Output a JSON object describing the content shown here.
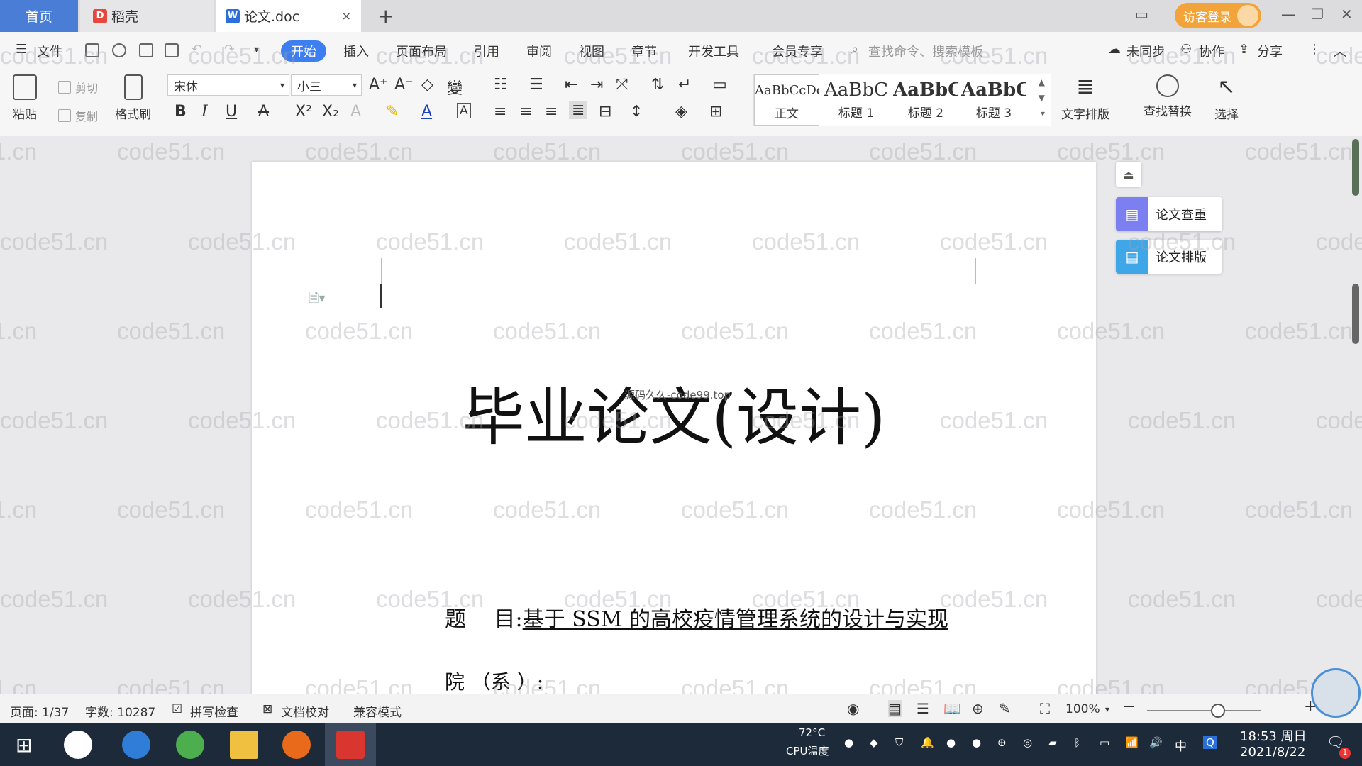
{
  "tabs": {
    "home": "首页",
    "daoke": "稻壳",
    "doc": "论文.doc",
    "close": "×",
    "add": "+"
  },
  "login": "访客登录",
  "menu": {
    "file": "文件",
    "start": "开始",
    "insert": "插入",
    "layout": "页面布局",
    "refs": "引用",
    "review": "审阅",
    "view": "视图",
    "chapter": "章节",
    "devtools": "开发工具",
    "member": "会员专享",
    "search_placeholder": "查找命令、搜索模板",
    "unsynced": "未同步",
    "collab": "协作",
    "share": "分享"
  },
  "ribbon": {
    "paste": "粘贴",
    "cut": "剪切",
    "copy": "复制",
    "format_painter": "格式刷",
    "font_name": "宋体",
    "font_size": "小三",
    "styles": [
      {
        "sample": "AaBbCcDd",
        "name": "正文"
      },
      {
        "sample": "AaBbC",
        "name": "标题 1"
      },
      {
        "sample": "AaBbC",
        "name": "标题 2"
      },
      {
        "sample": "AaBbC",
        "name": "标题 3"
      }
    ],
    "text_layout": "文字排版",
    "find_replace": "查找替换",
    "select": "选择"
  },
  "document": {
    "title": "毕业论文(设计)",
    "overlay": "源码久久-code99.top",
    "topic_label": "题　 目:",
    "topic_value": "基于 SSM 的高校疫情管理系统的设计与实现",
    "dept_label": "院 （系 ）:"
  },
  "side_panel": {
    "check": "论文查重",
    "format": "论文排版"
  },
  "watermark": "code51.cn",
  "status": {
    "page": "页面: 1/37",
    "words": "字数: 10287",
    "spell": "拼写检查",
    "proof": "文档校对",
    "compat": "兼容模式",
    "zoom": "100%"
  },
  "taskbar": {
    "cpu_temp": "72°C",
    "cpu_label": "CPU温度",
    "ime": "中",
    "time": "18:53 周日",
    "date": "2021/8/22",
    "notify_count": "1"
  }
}
